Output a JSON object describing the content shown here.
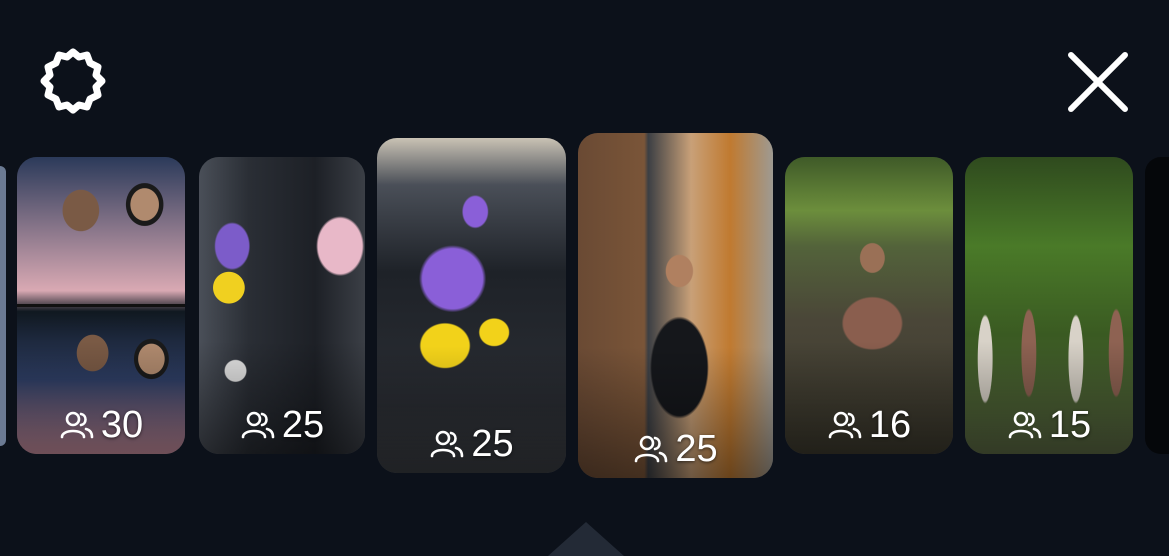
{
  "icons": {
    "settings": "gear-icon",
    "close": "close-icon",
    "people": "people-icon"
  },
  "colors": {
    "background": "#0c111a",
    "icon": "#ffffff",
    "text": "#ffffff"
  },
  "cards": [
    {
      "count": "30"
    },
    {
      "count": "25"
    },
    {
      "count": "25",
      "selected": true
    },
    {
      "count": "25"
    },
    {
      "count": "16"
    },
    {
      "count": "15"
    }
  ]
}
